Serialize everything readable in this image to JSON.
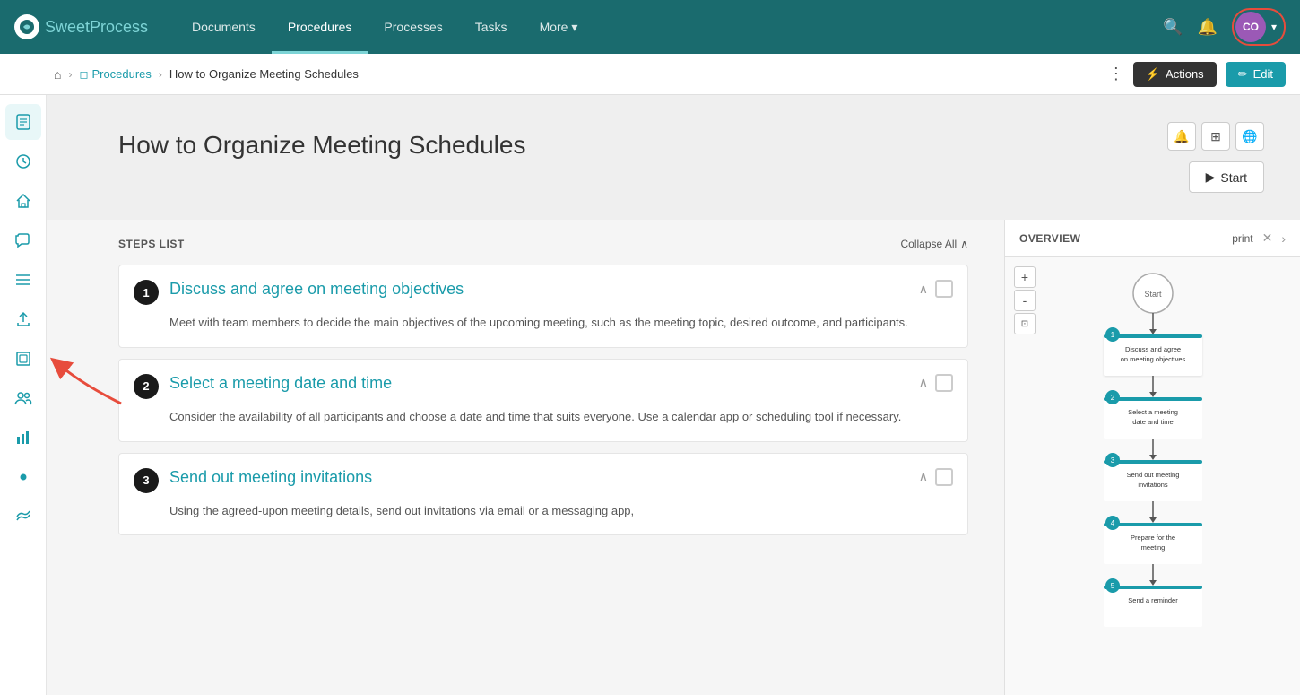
{
  "app": {
    "name": "Sweet",
    "name_accent": "Process",
    "logo_initials": "SP"
  },
  "nav": {
    "items": [
      {
        "label": "Documents",
        "active": false
      },
      {
        "label": "Procedures",
        "active": true
      },
      {
        "label": "Processes",
        "active": false
      },
      {
        "label": "Tasks",
        "active": false
      },
      {
        "label": "More",
        "active": false,
        "has_arrow": true
      }
    ]
  },
  "user": {
    "initials": "CO",
    "avatar_color": "#9b59b6"
  },
  "breadcrumb": {
    "home_icon": "⌂",
    "procedures_label": "Procedures",
    "current_page": "How to Organize Meeting Schedules",
    "actions_label": "Actions",
    "edit_label": "Edit"
  },
  "sidebar": {
    "icons": [
      {
        "name": "document-icon",
        "symbol": "◻",
        "active": true
      },
      {
        "name": "clock-icon",
        "symbol": "🕐",
        "active": false
      },
      {
        "name": "home-icon",
        "symbol": "⌂",
        "active": false
      },
      {
        "name": "chat-icon",
        "symbol": "💬",
        "active": false
      },
      {
        "name": "list-icon",
        "symbol": "≡",
        "active": false
      },
      {
        "name": "upload-icon",
        "symbol": "↑",
        "active": false
      },
      {
        "name": "copy-icon",
        "symbol": "⊡",
        "active": false
      },
      {
        "name": "team-icon",
        "symbol": "👥",
        "active": false
      },
      {
        "name": "chart-icon",
        "symbol": "📊",
        "active": false
      },
      {
        "name": "dot-icon",
        "symbol": "●",
        "active": false
      },
      {
        "name": "wave-icon",
        "symbol": "~",
        "active": false
      }
    ]
  },
  "procedure": {
    "title": "How to Organize Meeting Schedules",
    "start_label": "Start",
    "toolbar": {
      "bell_icon": "🔔",
      "columns_icon": "⊞",
      "globe_icon": "🌐"
    }
  },
  "steps": {
    "header": "STEPS LIST",
    "collapse_all": "Collapse All",
    "items": [
      {
        "number": "1",
        "title": "Discuss and agree on meeting objectives",
        "body": "Meet with team members to decide the main objectives of the upcoming meeting, such as the meeting topic, desired outcome, and participants."
      },
      {
        "number": "2",
        "title": "Select a meeting date and time",
        "body": "Consider the availability of all participants and choose a date and time that suits everyone. Use a calendar app or scheduling tool if necessary."
      },
      {
        "number": "3",
        "title": "Send out meeting invitations",
        "body": "Using the agreed-upon meeting details, send out invitations via email or a messaging app,"
      }
    ]
  },
  "overview": {
    "title": "OVERVIEW",
    "print_label": "print",
    "flowchart": {
      "start_label": "Start",
      "nodes": [
        {
          "number": "1",
          "label": "Discuss and agree on meeting objectives"
        },
        {
          "number": "2",
          "label": "Select a meeting date and time"
        },
        {
          "number": "3",
          "label": "Send out meeting invitations"
        },
        {
          "number": "4",
          "label": "Prepare for the meeting"
        },
        {
          "number": "5",
          "label": "Send a reminder"
        }
      ]
    },
    "zoom_plus": "+",
    "zoom_minus": "-",
    "zoom_fit": "⊡"
  }
}
